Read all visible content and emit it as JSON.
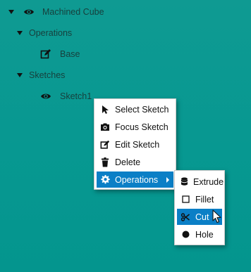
{
  "tree": {
    "root_label": "Machined Cube",
    "operations_label": "Operations",
    "base_label": "Base",
    "sketches_label": "Sketches",
    "sketch1_label": "Sketch1"
  },
  "context_menu": {
    "items": [
      {
        "label": "Select Sketch",
        "icon": "cursor-arrow-icon"
      },
      {
        "label": "Focus Sketch",
        "icon": "camera-icon"
      },
      {
        "label": "Edit Sketch",
        "icon": "edit-icon"
      },
      {
        "label": "Delete",
        "icon": "trash-icon"
      },
      {
        "label": "Operations",
        "icon": "gear-icon",
        "active": true,
        "has_submenu": true
      }
    ]
  },
  "submenu": {
    "items": [
      {
        "label": "Extrude",
        "icon": "database-icon"
      },
      {
        "label": "Fillet",
        "icon": "square-outline-icon"
      },
      {
        "label": "Cut",
        "icon": "scissors-icon",
        "active": true
      },
      {
        "label": "Hole",
        "icon": "filled-circle-icon"
      }
    ]
  },
  "colors": {
    "background": "#079891",
    "menu_highlight": "#0b7fc6",
    "tree_text": "#173f3c"
  }
}
